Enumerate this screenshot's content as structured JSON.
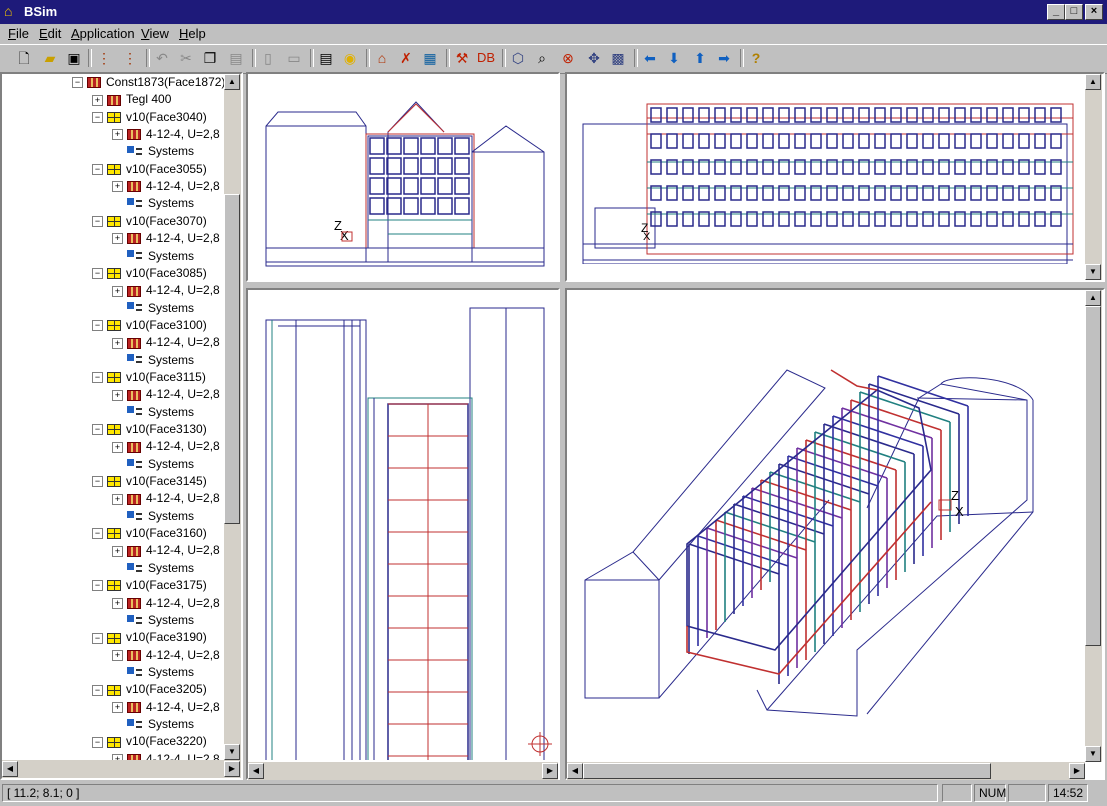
{
  "window": {
    "title": "BSim",
    "buttons": [
      "_",
      "□",
      "×"
    ]
  },
  "menu": [
    "File",
    "Edit",
    "Application",
    "View",
    "Help"
  ],
  "toolbar_icons": [
    "new-icon",
    "open-icon",
    "save-icon",
    "tree-icon",
    "tree-edit-icon",
    "undo-icon",
    "cut-icon",
    "copy-icon",
    "paste-icon",
    "preview-icon",
    "print-icon",
    "report-icon",
    "light-icon",
    "house-icon",
    "delete-house-icon",
    "building-icon",
    "tool-icon",
    "db-icon",
    "cube-icon",
    "zoom-icon",
    "zoom-out-icon",
    "pan-icon",
    "fit-icon",
    "arrow-left-icon",
    "arrow-down-icon",
    "arrow-up-icon",
    "arrow-right-icon",
    "help-icon"
  ],
  "toolbar_db_label": "DB",
  "tree": {
    "root": "Const1873(Face1872)",
    "root_child": "Tegl 400",
    "faces": [
      "v10(Face3040)",
      "v10(Face3055)",
      "v10(Face3070)",
      "v10(Face3085)",
      "v10(Face3100)",
      "v10(Face3115)",
      "v10(Face3130)",
      "v10(Face3145)",
      "v10(Face3160)",
      "v10(Face3175)",
      "v10(Face3190)",
      "v10(Face3205)",
      "v10(Face3220)"
    ],
    "glazing": "4-12-4, U=2,8",
    "systems": "Systems"
  },
  "status": {
    "coords": "[ 11.2; 8.1; 0 ]",
    "num": "NUM",
    "time": "14:52"
  },
  "colors": {
    "titlebar": "#1e1a7a",
    "line_blue": "#2a2a8c",
    "line_red": "#c03030",
    "line_teal": "#208080"
  }
}
